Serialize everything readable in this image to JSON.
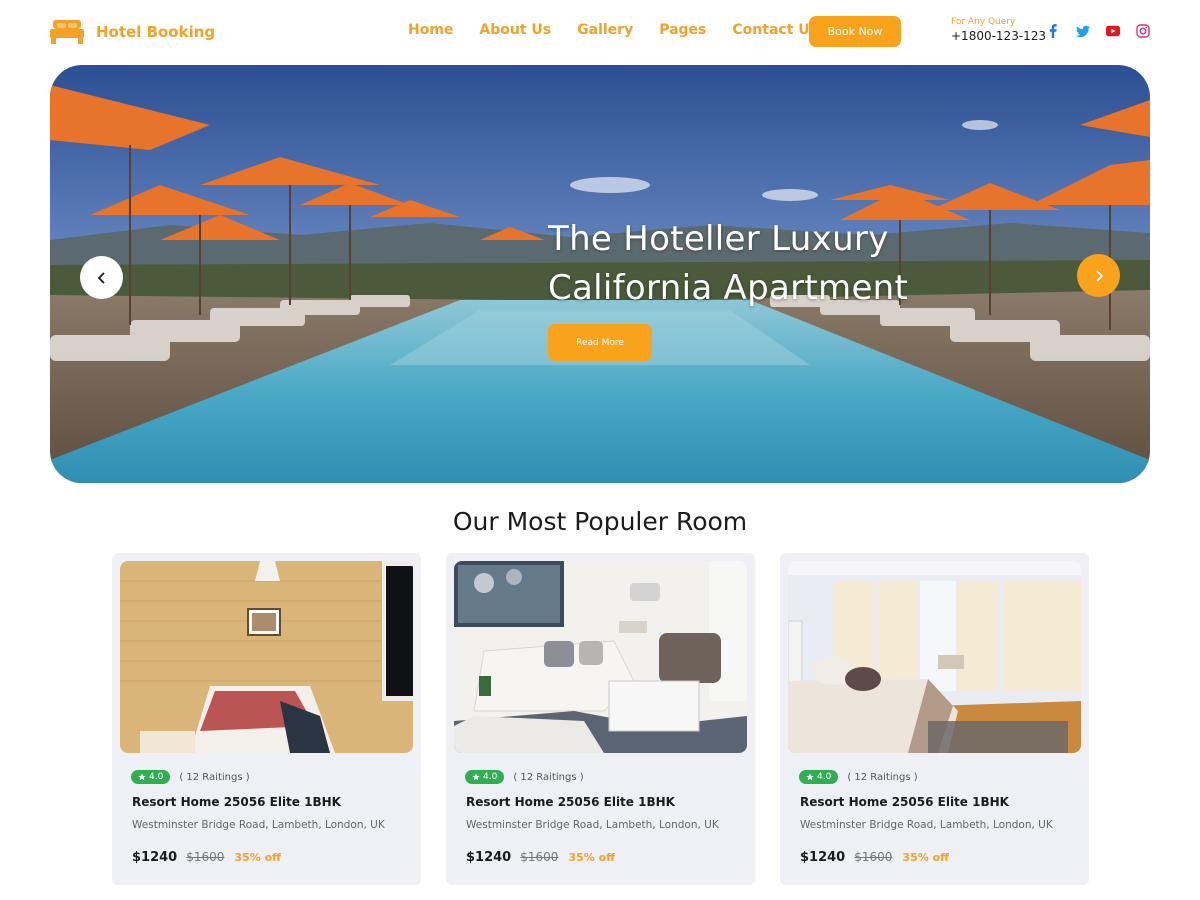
{
  "brand": {
    "name": "Hotel Booking",
    "icon": "bed-icon",
    "accent": "#f9a21b"
  },
  "nav": {
    "items": [
      "Home",
      "About Us",
      "Gallery",
      "Pages",
      "Contact Us"
    ],
    "book_label": "Book Now"
  },
  "contact": {
    "label": "For Any Query",
    "phone": "+1800-123-123"
  },
  "socials": [
    "facebook-icon",
    "twitter-icon",
    "youtube-icon",
    "instagram-icon"
  ],
  "hero": {
    "title_line1": "The Hoteller Luxury",
    "title_line2": "California Apartment",
    "cta": "Read More",
    "prev_icon": "chevron-left-icon",
    "next_icon": "chevron-right-icon"
  },
  "section": {
    "title": "Our Most Populer Room"
  },
  "rooms": [
    {
      "rating": "4.0",
      "ratings_text": "( 12 Raitings )",
      "name": "Resort Home 25056 Elite 1BHK",
      "address": "Westminster Bridge Road, Lambeth, London, UK",
      "price": "$1240",
      "old_price": "$1600",
      "discount": "35% off"
    },
    {
      "rating": "4.0",
      "ratings_text": "( 12 Raitings )",
      "name": "Resort Home 25056 Elite 1BHK",
      "address": "Westminster Bridge Road, Lambeth, London, UK",
      "price": "$1240",
      "old_price": "$1600",
      "discount": "35% off"
    },
    {
      "rating": "4.0",
      "ratings_text": "( 12 Raitings )",
      "name": "Resort Home 25056 Elite 1BHK",
      "address": "Westminster Bridge Road, Lambeth, London, UK",
      "price": "$1240",
      "old_price": "$1600",
      "discount": "35% off"
    }
  ]
}
